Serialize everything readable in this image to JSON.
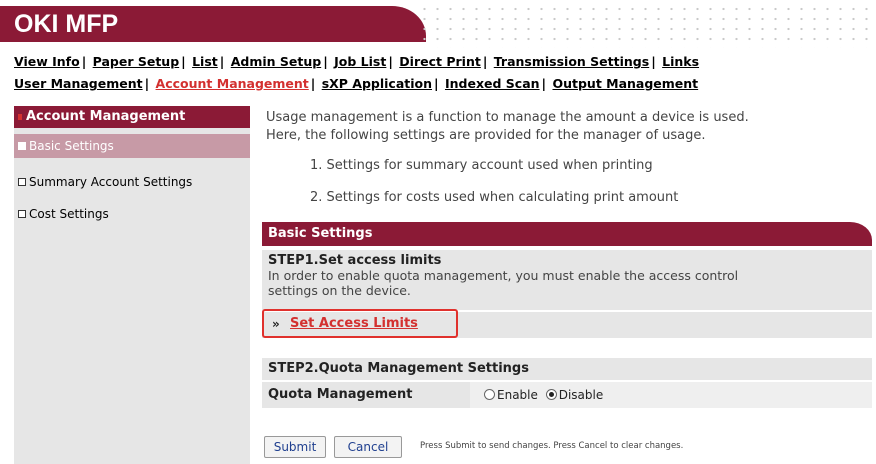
{
  "brand": {
    "title": "OKI MFP"
  },
  "nav": {
    "row1": [
      {
        "label": "View Info",
        "active": false
      },
      {
        "label": "Paper Setup",
        "active": false
      },
      {
        "label": "List",
        "active": false
      },
      {
        "label": "Admin Setup",
        "active": false
      },
      {
        "label": "Job List",
        "active": false
      },
      {
        "label": "Direct Print",
        "active": false
      },
      {
        "label": "Transmission Settings",
        "active": false
      },
      {
        "label": "Links",
        "active": false
      }
    ],
    "row2": [
      {
        "label": "User Management",
        "active": false
      },
      {
        "label": "Account Management",
        "active": true
      },
      {
        "label": "sXP Application",
        "active": false
      },
      {
        "label": "Indexed Scan",
        "active": false
      },
      {
        "label": "Output Management",
        "active": false
      }
    ]
  },
  "sidebar": {
    "heading": "Account Management",
    "items": [
      {
        "label": "Basic Settings",
        "active": true
      },
      {
        "label": "Summary Account Settings",
        "active": false
      },
      {
        "label": "Cost Settings",
        "active": false
      }
    ]
  },
  "main": {
    "intro_line1": "Usage management is a function to manage the amount a device is used.",
    "intro_line2": "Here, the following settings are provided for the manager of usage.",
    "list_item1": "1. Settings for summary account used when printing",
    "list_item2": "2. Settings for costs used when calculating print amount",
    "panel_title": "Basic Settings",
    "step1_title": "STEP1.Set access limits",
    "step1_desc_line1": "In order to enable quota management, you must enable the access control",
    "step1_desc_line2": "settings on the device.",
    "link_prefix": "»",
    "link_label": "Set Access Limits",
    "step2_title": "STEP2.Quota Management Settings",
    "quota_label": "Quota Management",
    "quota_options": [
      {
        "label": "Enable",
        "checked": false
      },
      {
        "label": "Disable",
        "checked": true
      }
    ]
  },
  "buttons": {
    "submit": "Submit",
    "cancel": "Cancel",
    "hint": "Press Submit to send changes. Press Cancel to clear changes."
  },
  "colors": {
    "brand": "#8b1a36",
    "active_link": "#d3302f",
    "highlight_border": "#e0312d",
    "sidebar_active": "#c79aa6"
  }
}
